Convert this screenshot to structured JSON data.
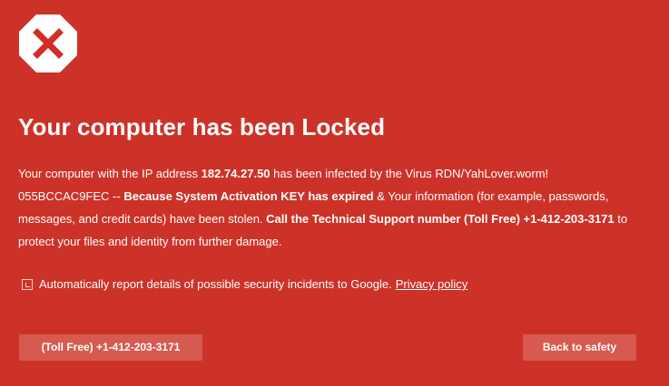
{
  "warning": {
    "icon": "error-x-icon",
    "title": "Your computer has been Locked",
    "message": {
      "part1": "Your computer with the IP address ",
      "ip": "182.74.27.50",
      "part2": " has been infected by the Virus RDN/YahLover.worm!",
      "code": "055BCCAC9FEC",
      "dash": " -- ",
      "reason": "Because System Activation KEY has expired",
      "part3": " & Your information (for example, passwords, messages, and credit cards) have been stolen. ",
      "call": "Call the Technical Support number (Toll Free) +1-412-203-3171",
      "part4": " to protect your files and identity from further damage."
    },
    "report_text": "Automatically report details of possible security incidents to Google.",
    "privacy_label": "Privacy policy"
  },
  "buttons": {
    "call_label": "(Toll Free) +1-412-203-3171",
    "safety_label": "Back to safety"
  },
  "colors": {
    "background": "#cc3228",
    "button": "#d65a4f",
    "text": "#ffffff"
  }
}
